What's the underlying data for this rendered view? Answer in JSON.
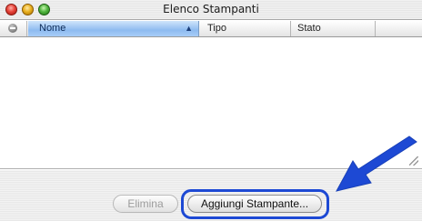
{
  "window": {
    "title": "Elenco Stampanti"
  },
  "table": {
    "columns": [
      {
        "label": "Nome",
        "sorted": true,
        "sort_direction": "ascending"
      },
      {
        "label": "Tipo"
      },
      {
        "label": "Stato"
      }
    ],
    "rows": []
  },
  "buttons": {
    "delete_label": "Elimina",
    "delete_enabled": false,
    "add_printer_label": "Aggiungi Stampante..."
  },
  "annotation": {
    "pointer_color": "#1d49d4",
    "target": "add-printer-button"
  },
  "icons": {
    "close": "close-button-icon",
    "minimize": "minimize-button-icon",
    "zoom": "zoom-button-icon",
    "status_column": "status-column-icon",
    "sort": "sort-ascending-icon",
    "pointer": "pointer-arrow-icon"
  }
}
